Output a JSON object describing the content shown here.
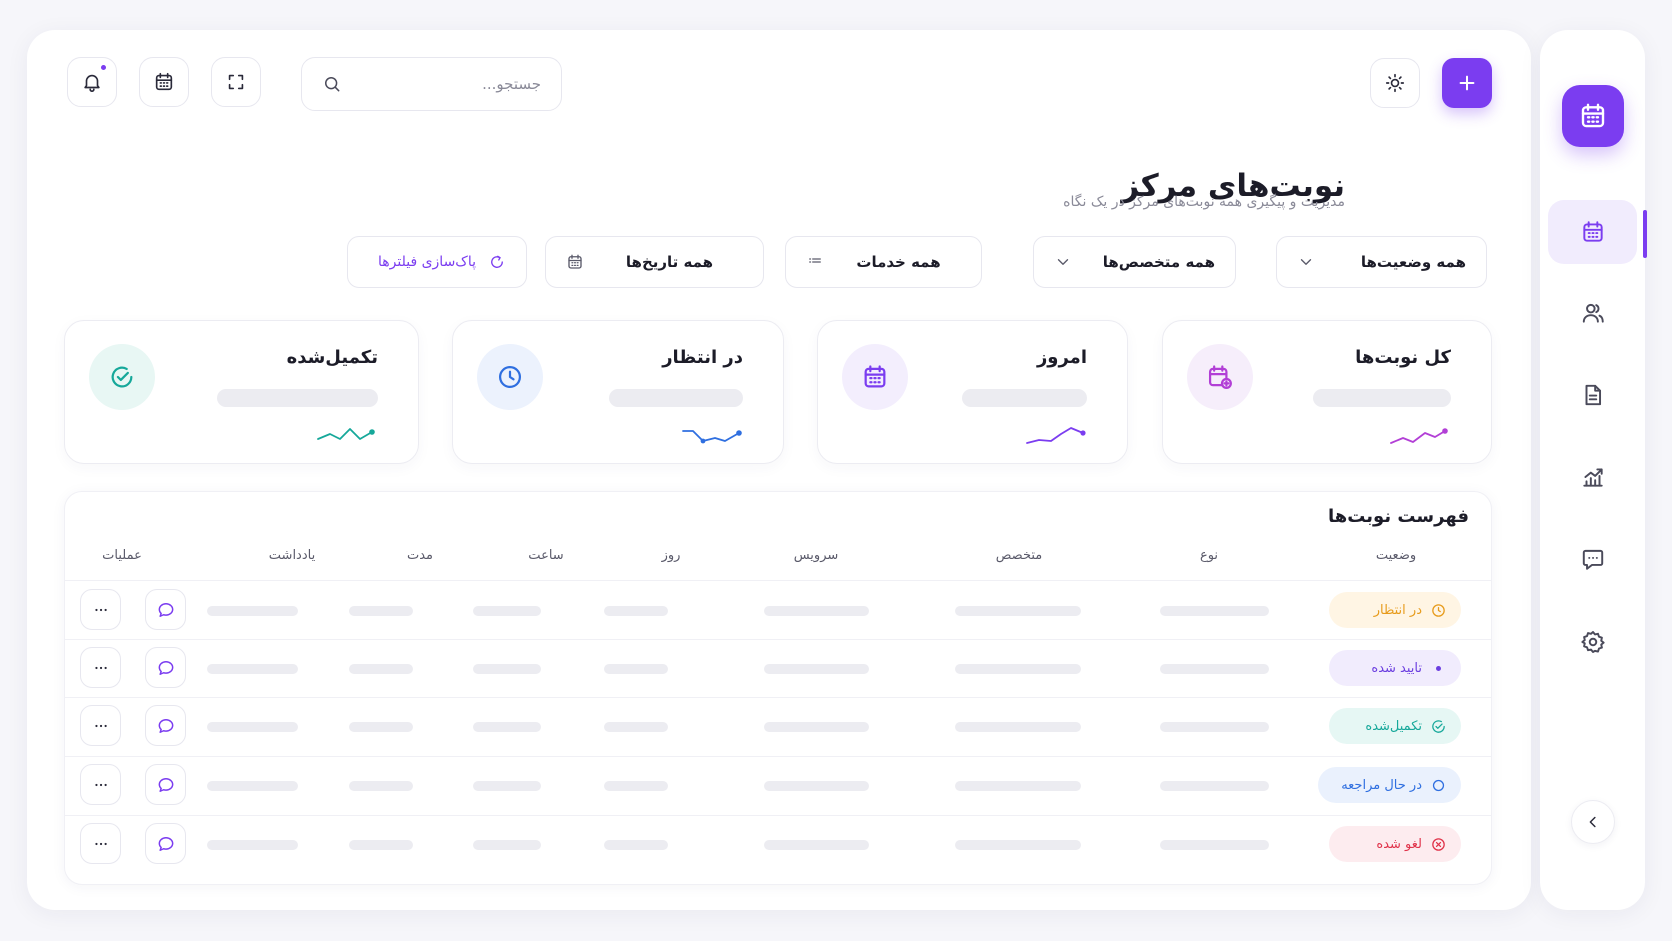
{
  "header": {
    "search_placeholder": "جستجو...",
    "title": "نوبت‌های مرکز",
    "subtitle": "مدیریت و پیگیری همه نوبت‌های مرکز در یک نگاه"
  },
  "filters": {
    "status": "همه وضعیت‌ها",
    "specialist": "همه متخصص‌ها",
    "services": "همه خدمات",
    "dates": "همه تاریخ‌ها",
    "reset": "پاک‌سازی فیلترها"
  },
  "stats": [
    {
      "title": "کل نوبت‌ها",
      "color": "#b23fd6"
    },
    {
      "title": "امروز",
      "color": "#7b3df0"
    },
    {
      "title": "در انتظار",
      "color": "#2f6fe0"
    },
    {
      "title": "تکمیل‌شده",
      "color": "#16a89a"
    }
  ],
  "table": {
    "title": "فهرست نوبت‌ها",
    "columns": {
      "status": "وضعیت",
      "type": "نوع",
      "specialist": "متخصص",
      "service": "سرویس",
      "day": "روز",
      "time": "ساعت",
      "duration": "مدت",
      "note": "یادداشت",
      "actions": "عملیات"
    },
    "rows": [
      {
        "status": "در انتظار",
        "status_color": "#e79b1b",
        "status_bg": "#fff5e4"
      },
      {
        "status": "تایید شده",
        "status_color": "#6b3ee0",
        "status_bg": "#f1ecfd"
      },
      {
        "status": "تکمیل‌شده",
        "status_color": "#16a89a",
        "status_bg": "#e6f7f4"
      },
      {
        "status": "در حال مراجعه",
        "status_color": "#2f6fe0",
        "status_bg": "#eaf1fd"
      },
      {
        "status": "لغو شده",
        "status_color": "#e0334a",
        "status_bg": "#fdecef"
      }
    ]
  },
  "colors": {
    "accent": "#7b3df0"
  }
}
